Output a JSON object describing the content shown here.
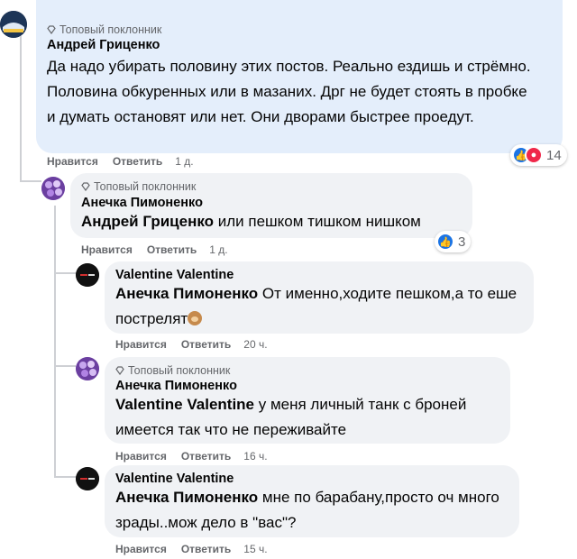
{
  "colors": {
    "link": "#1b74e4",
    "muted": "#65676b",
    "bubble": "#f0f2f5",
    "bubble_top": "#e4eefb"
  },
  "top_avatar_label": "Дп НАК",
  "comments": [
    {
      "badge": "Топовый поклонник",
      "author": "Андрей Гриценко",
      "text": "Да надо убирать половину этих постов. Реально ездишь и стрёмно. Половина обкуренных или в мазаних. Дрг не будет стоять в пробке и думать остановят или нет. Они дворами быстрее проедут.",
      "like": "Нравится",
      "reply": "Ответить",
      "time": "1 д.",
      "reaction_count": "14",
      "reaction_icons": [
        "like-icon",
        "angry-icon"
      ]
    },
    {
      "badge": "Топовый поклонник",
      "author": "Анечка Пимоненко",
      "mention": "Андрей Гриценко",
      "text": " или пешком тишком нишком",
      "like": "Нравится",
      "reply": "Ответить",
      "time": "1 д.",
      "reaction_count": "3",
      "reaction_icons": [
        "like-icon"
      ]
    },
    {
      "author": "Valentine Valentine",
      "mention": "Анечка Пимоненко",
      "text": " От именно,ходите пешком,а то еше пострелят",
      "emoji": "monkey-emoji",
      "like": "Нравится",
      "reply": "Ответить",
      "time": "20 ч."
    },
    {
      "badge": "Топовый поклонник",
      "author": "Анечка Пимоненко",
      "mention": "Valentine Valentine",
      "text": " у меня личный танк с броней имеется так что не переживайте",
      "like": "Нравится",
      "reply": "Ответить",
      "time": "16 ч."
    },
    {
      "author": "Valentine Valentine",
      "mention": "Анечка Пимоненко",
      "text": " мне по барабану,просто оч много зрады..мож дело в \"вас\"?",
      "like": "Нравится",
      "reply": "Ответить",
      "time": "15 ч."
    }
  ]
}
